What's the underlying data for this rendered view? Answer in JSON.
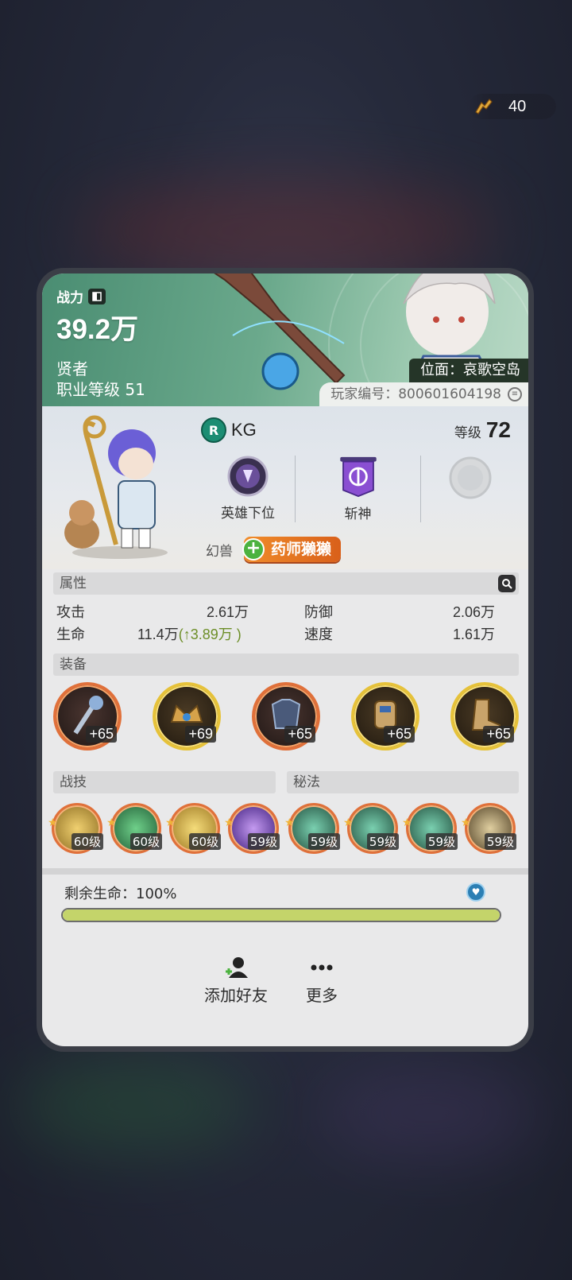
{
  "top_bar": {
    "energy_value": "40",
    "energy_icon": "stamina-icon"
  },
  "banner": {
    "power_label": "战力",
    "power_value": "39.2万",
    "class_name": "贤者",
    "class_level": "职业等级 51",
    "location": "位面：哀歌空岛",
    "player_id": "玩家编号：800601604198"
  },
  "profile": {
    "name": "KG",
    "level_label": "等级",
    "level_value": "72",
    "honors": [
      {
        "label": "英雄下位",
        "icon": "hero-rank-emblem-icon"
      },
      {
        "label": "斩神",
        "icon": "guild-banner-icon"
      },
      {
        "label": "",
        "icon": "empty-slot-icon"
      }
    ],
    "beast_label": "幻兽",
    "beast_name": "药师獭獭"
  },
  "attributes": {
    "title": "属性",
    "attack_label": "攻击",
    "attack_value": "2.61万",
    "defense_label": "防御",
    "defense_value": "2.06万",
    "hp_label": "生命",
    "hp_value": "11.4万",
    "hp_bonus_open": "(",
    "hp_bonus": "3.89万",
    "hp_bonus_close": " )",
    "speed_label": "速度",
    "speed_value": "1.61万"
  },
  "equipment": {
    "title": "装备",
    "items": [
      {
        "level": "+65",
        "rarity": "red",
        "icon": "staff-icon"
      },
      {
        "level": "+69",
        "rarity": "gold",
        "icon": "crown-icon"
      },
      {
        "level": "+65",
        "rarity": "red",
        "icon": "armor-icon"
      },
      {
        "level": "+65",
        "rarity": "gold",
        "icon": "gauntlet-icon"
      },
      {
        "level": "+65",
        "rarity": "gold",
        "icon": "boots-icon"
      }
    ]
  },
  "skills": {
    "title": "战技",
    "items": [
      {
        "level": "60级",
        "color": "#c9a43a"
      },
      {
        "level": "60级",
        "color": "#2f8a4a"
      },
      {
        "level": "60级",
        "color": "#d8a93a"
      },
      {
        "level": "59级",
        "color": "#7a3fbf"
      }
    ]
  },
  "secrets": {
    "title": "秘法",
    "items": [
      {
        "level": "59级",
        "color": "#2a6e52"
      },
      {
        "level": "59级",
        "color": "#2a6e52"
      },
      {
        "level": "59级",
        "color": "#2a6e52"
      },
      {
        "level": "59级",
        "color": "#7a6a4a"
      }
    ]
  },
  "health": {
    "label": "剩余生命：100%",
    "fraction": 1.0
  },
  "actions": {
    "add_friend": "添加好友",
    "more": "更多"
  }
}
